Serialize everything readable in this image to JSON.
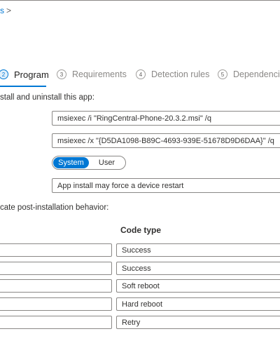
{
  "breadcrumb": {
    "text": "s",
    "separator": ">"
  },
  "steps": [
    {
      "number": "2",
      "label": "Program",
      "active": true
    },
    {
      "number": "3",
      "label": "Requirements",
      "active": false
    },
    {
      "number": "4",
      "label": "Detection rules",
      "active": false
    },
    {
      "number": "5",
      "label": "Dependencies",
      "active": false
    }
  ],
  "program": {
    "intro": "stall and uninstall this app:",
    "install_command": "msiexec /i \"RingCentral-Phone-20.3.2.msi\" /q",
    "uninstall_command": "msiexec /x \"{D5DA1098-B89C-4693-939E-51678D9D6DAA}\" /q",
    "install_behavior": {
      "options": [
        "System",
        "User"
      ],
      "selected": "System"
    },
    "device_restart": "App install may force a device restart"
  },
  "return_codes": {
    "intro": "cate post-installation behavior:",
    "code_type_header": "Code type",
    "rows": [
      {
        "code": "",
        "type": "Success"
      },
      {
        "code": "",
        "type": "Success"
      },
      {
        "code": "",
        "type": "Soft reboot"
      },
      {
        "code": "",
        "type": "Hard reboot"
      },
      {
        "code": "",
        "type": "Retry"
      }
    ]
  },
  "colors": {
    "accent": "#0078d4",
    "border": "#8a8886",
    "text": "#323130"
  }
}
